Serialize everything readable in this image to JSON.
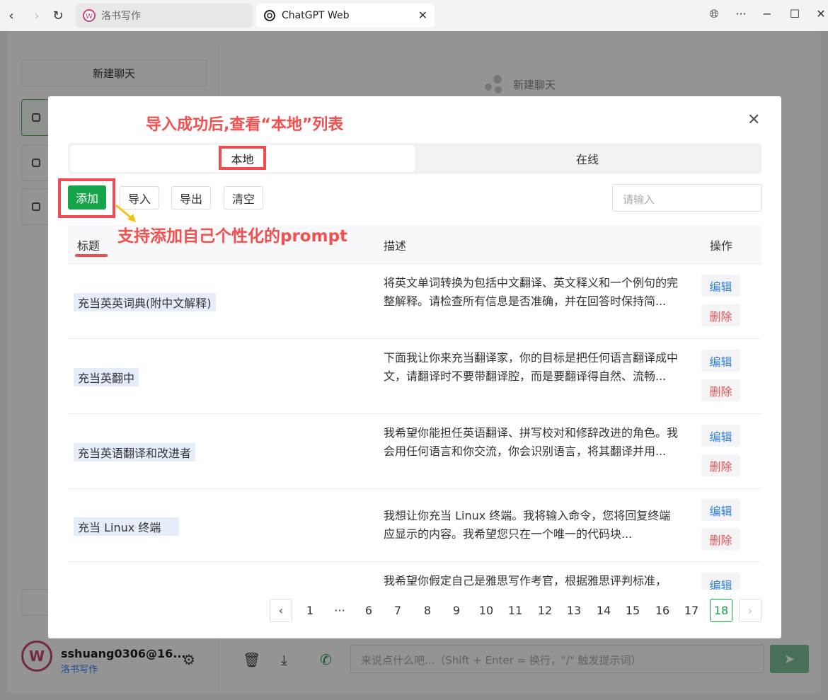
{
  "browser": {
    "tabs": [
      {
        "label": "洛书写作"
      },
      {
        "label": "ChatGPT Web"
      }
    ]
  },
  "sidebar": {
    "new_chat": "新建聊天"
  },
  "main": {
    "title": "新建聊天"
  },
  "modal": {
    "annotation_title": "导入成功后,查看“本地”列表",
    "tabs": {
      "local": "本地",
      "online": "在线"
    },
    "toolbar": {
      "add": "添加",
      "import": "导入",
      "export": "导出",
      "clear": "清空",
      "search_placeholder": "请输入"
    },
    "annotation_sub": "支持添加自己个性化的prompt",
    "columns": {
      "title": "标题",
      "desc": "描述",
      "ops": "操作"
    },
    "rows": [
      {
        "title": "充当英英词典(附中文解释)",
        "desc": "将英文单词转换为包括中文翻译、英文释义和一个例句的完整解释。请检查所有信息是否准确，并在回答时保持简..."
      },
      {
        "title": "充当英翻中",
        "desc": "下面我让你来充当翻译家，你的目标是把任何语言翻译成中文，请翻译时不要带翻译腔，而是要翻译得自然、流畅..."
      },
      {
        "title": "充当英语翻译和改进者",
        "desc": "我希望你能担任英语翻译、拼写校对和修辞改进的角色。我会用任何语言和你交流，你会识别语言，将其翻译并用..."
      },
      {
        "title": "充当 Linux 终端",
        "desc": "我想让你充当 Linux 终端。我将输入命令，您将回复终端应显示的内容。我希望您只在一个唯一的代码块..."
      },
      {
        "title": "",
        "desc": "我希望你假定自己是雅思写作考官，根据雅思评判标准，"
      }
    ],
    "ops": {
      "edit": "编辑",
      "delete": "删除"
    },
    "pagination": {
      "prev": "‹",
      "pages": [
        "1",
        "···",
        "6",
        "7",
        "8",
        "9",
        "10",
        "11",
        "12",
        "13",
        "14",
        "15",
        "16",
        "17",
        "18"
      ],
      "current": "18",
      "next": "›"
    }
  },
  "footer": {
    "user_name": "sshuang0306@16...",
    "user_sub": "洛书写作",
    "input_placeholder": "来说点什么吧...（Shift + Enter = 换行，\"/\" 触发提示词）"
  },
  "colors": {
    "accent_green": "#17a34a",
    "annotation_red": "#ef4b51",
    "link_blue": "#2f7fd9"
  }
}
